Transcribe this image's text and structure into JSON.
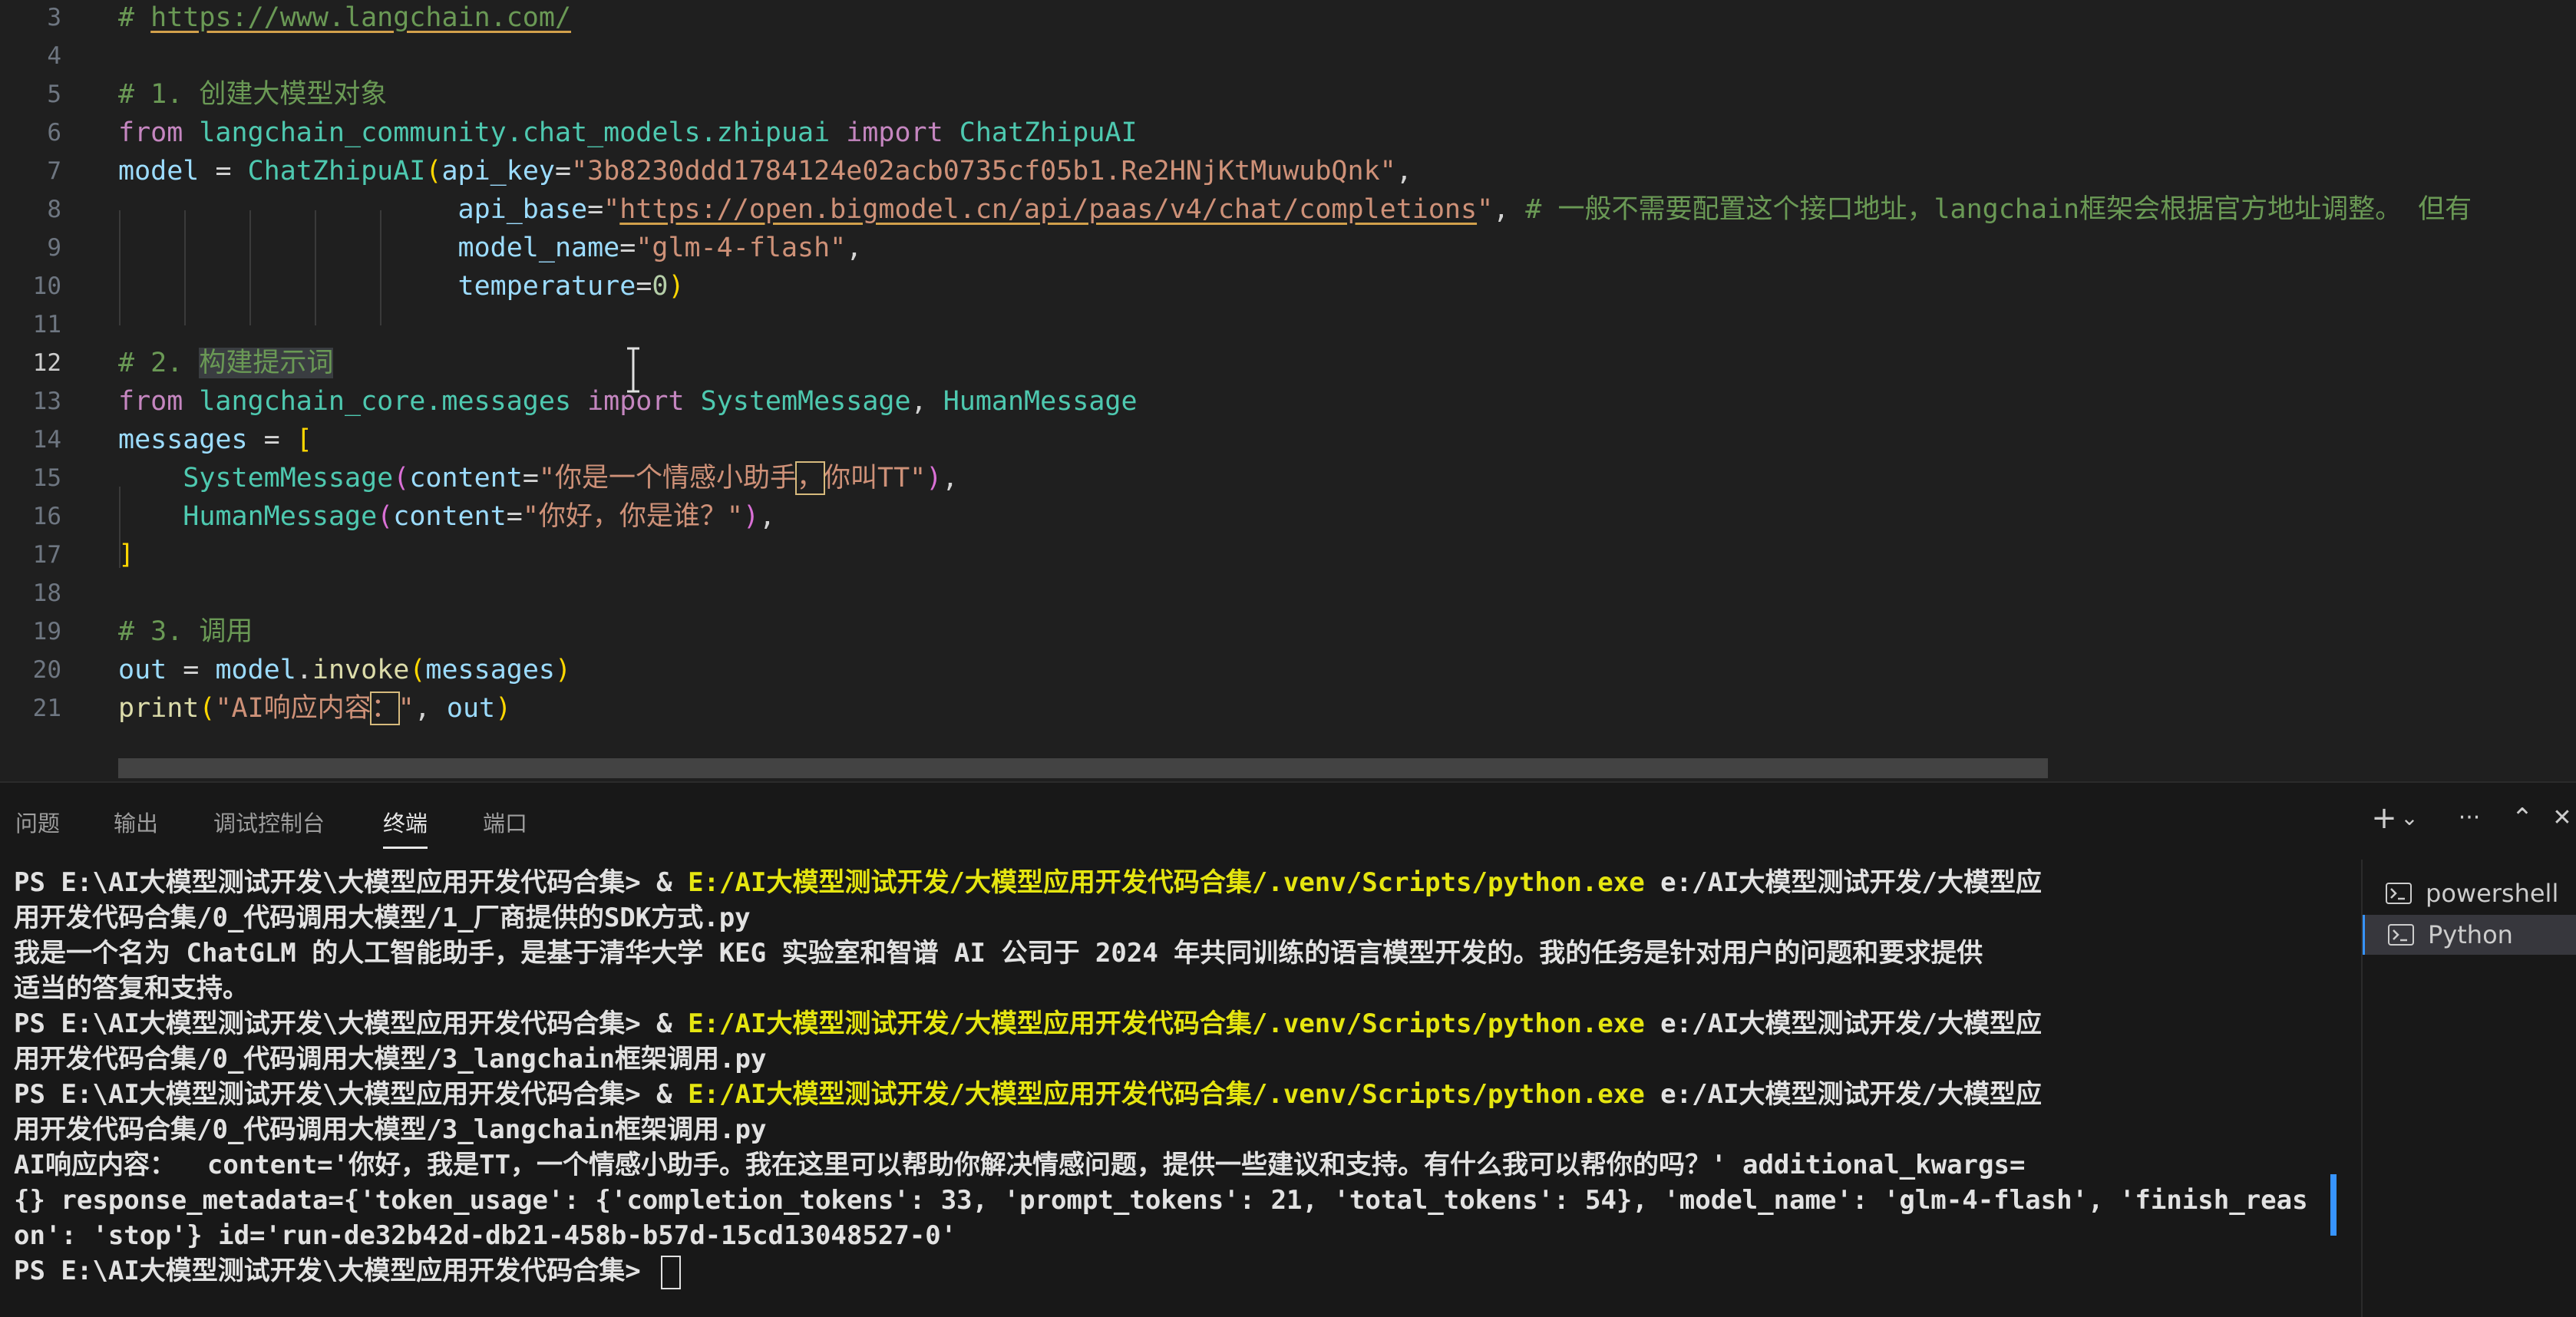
{
  "editor": {
    "lines": [
      {
        "n": "3",
        "tokens": [
          {
            "t": "# ",
            "c": "com"
          },
          {
            "t": "https://www.langchain.com/",
            "c": "com ul"
          }
        ]
      },
      {
        "n": "4",
        "tokens": []
      },
      {
        "n": "5",
        "tokens": [
          {
            "t": "# 1. 创建大模型对象",
            "c": "com"
          }
        ]
      },
      {
        "n": "6",
        "tokens": [
          {
            "t": "from ",
            "c": "kw"
          },
          {
            "t": "langchain_community.chat_models.zhipuai ",
            "c": "cls"
          },
          {
            "t": "import ",
            "c": "kw"
          },
          {
            "t": "ChatZhipuAI",
            "c": "cls"
          }
        ]
      },
      {
        "n": "7",
        "tokens": [
          {
            "t": "model ",
            "c": "var"
          },
          {
            "t": "= ",
            "c": "op"
          },
          {
            "t": "ChatZhipuAI",
            "c": "cls"
          },
          {
            "t": "(",
            "c": "br1"
          },
          {
            "t": "api_key",
            "c": "var"
          },
          {
            "t": "=",
            "c": "op"
          },
          {
            "t": "\"3b8230ddd1784124e02acb0735cf05b1.Re2HNjKtMuwubQnk\"",
            "c": "str"
          },
          {
            "t": ",",
            "c": "op"
          }
        ]
      },
      {
        "n": "8",
        "tokens": [
          {
            "t": "                     ",
            "c": "op"
          },
          {
            "t": "api_base",
            "c": "var"
          },
          {
            "t": "=",
            "c": "op"
          },
          {
            "t": "\"",
            "c": "str"
          },
          {
            "t": "https://open.bigmodel.cn/api/paas/v4/chat/completions",
            "c": "str ul"
          },
          {
            "t": "\"",
            "c": "str"
          },
          {
            "t": ", ",
            "c": "op"
          },
          {
            "t": "# 一般不需要配置这个接口地址，langchain框架会根据官方地址调整。 但有",
            "c": "com"
          }
        ]
      },
      {
        "n": "9",
        "tokens": [
          {
            "t": "                     ",
            "c": "op"
          },
          {
            "t": "model_name",
            "c": "var"
          },
          {
            "t": "=",
            "c": "op"
          },
          {
            "t": "\"glm-4-flash\"",
            "c": "str"
          },
          {
            "t": ",",
            "c": "op"
          }
        ]
      },
      {
        "n": "10",
        "tokens": [
          {
            "t": "                     ",
            "c": "op"
          },
          {
            "t": "temperature",
            "c": "var"
          },
          {
            "t": "=",
            "c": "op"
          },
          {
            "t": "0",
            "c": "num"
          },
          {
            "t": ")",
            "c": "br1"
          }
        ]
      },
      {
        "n": "11",
        "tokens": []
      },
      {
        "n": "12",
        "tokens": [
          {
            "t": "# 2. ",
            "c": "com"
          },
          {
            "t": "构建提示词",
            "c": "com sel"
          }
        ]
      },
      {
        "n": "13",
        "tokens": [
          {
            "t": "from ",
            "c": "kw"
          },
          {
            "t": "langchain_core.messages ",
            "c": "cls"
          },
          {
            "t": "import ",
            "c": "kw"
          },
          {
            "t": "SystemMessage",
            "c": "cls"
          },
          {
            "t": ", ",
            "c": "op"
          },
          {
            "t": "HumanMessage",
            "c": "cls"
          }
        ]
      },
      {
        "n": "14",
        "tokens": [
          {
            "t": "messages ",
            "c": "var"
          },
          {
            "t": "= ",
            "c": "op"
          },
          {
            "t": "[",
            "c": "br1"
          }
        ]
      },
      {
        "n": "15",
        "tokens": [
          {
            "t": "    ",
            "c": "op"
          },
          {
            "t": "SystemMessage",
            "c": "cls"
          },
          {
            "t": "(",
            "c": "br2"
          },
          {
            "t": "content",
            "c": "var"
          },
          {
            "t": "=",
            "c": "op"
          },
          {
            "t": "\"你是一个情感小助手",
            "c": "str"
          },
          {
            "t": "，",
            "c": "str warnbox"
          },
          {
            "t": "你叫TT\"",
            "c": "str"
          },
          {
            "t": ")",
            "c": "br2"
          },
          {
            "t": ",",
            "c": "op"
          }
        ]
      },
      {
        "n": "16",
        "tokens": [
          {
            "t": "    ",
            "c": "op"
          },
          {
            "t": "HumanMessage",
            "c": "cls"
          },
          {
            "t": "(",
            "c": "br2"
          },
          {
            "t": "content",
            "c": "var"
          },
          {
            "t": "=",
            "c": "op"
          },
          {
            "t": "\"你好，你是谁？\"",
            "c": "str"
          },
          {
            "t": ")",
            "c": "br2"
          },
          {
            "t": ",",
            "c": "op"
          }
        ]
      },
      {
        "n": "17",
        "tokens": [
          {
            "t": "]",
            "c": "br1"
          }
        ]
      },
      {
        "n": "18",
        "tokens": []
      },
      {
        "n": "19",
        "tokens": [
          {
            "t": "# 3. 调用",
            "c": "com"
          }
        ]
      },
      {
        "n": "20",
        "tokens": [
          {
            "t": "out ",
            "c": "var"
          },
          {
            "t": "= ",
            "c": "op"
          },
          {
            "t": "model",
            "c": "var"
          },
          {
            "t": ".",
            "c": "op"
          },
          {
            "t": "invoke",
            "c": "fn"
          },
          {
            "t": "(",
            "c": "br1"
          },
          {
            "t": "messages",
            "c": "var"
          },
          {
            "t": ")",
            "c": "br1"
          }
        ]
      },
      {
        "n": "21",
        "tokens": [
          {
            "t": "print",
            "c": "fn"
          },
          {
            "t": "(",
            "c": "br1"
          },
          {
            "t": "\"AI响应内容",
            "c": "str"
          },
          {
            "t": "：",
            "c": "str warnbox"
          },
          {
            "t": "\"",
            "c": "str"
          },
          {
            "t": ", ",
            "c": "op"
          },
          {
            "t": "out",
            "c": "var"
          },
          {
            "t": ")",
            "c": "br1"
          }
        ]
      }
    ],
    "active_line": "12"
  },
  "panel": {
    "tabs": [
      "问题",
      "输出",
      "调试控制台",
      "终端",
      "端口"
    ],
    "active_tab": "终端",
    "actions": {
      "add": "+",
      "dropdown": "⌄",
      "more": "···",
      "maximize": "⌃",
      "close": "✕"
    },
    "terminals": [
      {
        "label": "powershell",
        "icon": "terminal-icon"
      },
      {
        "label": "Python",
        "icon": "terminal-icon"
      }
    ],
    "active_terminal": "Python"
  },
  "terminal": {
    "lines": [
      [
        {
          "t": "PS E:\\AI大模型测试开发\\大模型应用开发代码合集> & "
        },
        {
          "t": "E:/AI大模型测试开发/大模型应用开发代码合集/.venv/Scripts/python.exe",
          "c": "path-y"
        },
        {
          "t": " e:/AI大模型测试开发/大模型应"
        }
      ],
      [
        {
          "t": "用开发代码合集/0_代码调用大模型/1_厂商提供的SDK方式.py"
        }
      ],
      [
        {
          "t": "我是一个名为 ChatGLM 的人工智能助手，是基于清华大学 KEG 实验室和智谱 AI 公司于 2024 年共同训练的语言模型开发的。我的任务是针对用户的问题和要求提供"
        }
      ],
      [
        {
          "t": "适当的答复和支持。"
        }
      ],
      [
        {
          "t": "PS E:\\AI大模型测试开发\\大模型应用开发代码合集> & "
        },
        {
          "t": "E:/AI大模型测试开发/大模型应用开发代码合集/.venv/Scripts/python.exe",
          "c": "path-y"
        },
        {
          "t": " e:/AI大模型测试开发/大模型应"
        }
      ],
      [
        {
          "t": "用开发代码合集/0_代码调用大模型/3_langchain框架调用.py"
        }
      ],
      [
        {
          "t": "PS E:\\AI大模型测试开发\\大模型应用开发代码合集> & "
        },
        {
          "t": "E:/AI大模型测试开发/大模型应用开发代码合集/.venv/Scripts/python.exe",
          "c": "path-y"
        },
        {
          "t": " e:/AI大模型测试开发/大模型应"
        }
      ],
      [
        {
          "t": "用开发代码合集/0_代码调用大模型/3_langchain框架调用.py"
        }
      ],
      [
        {
          "t": "AI响应内容：  content='你好，我是TT，一个情感小助手。我在这里可以帮助你解决情感问题，提供一些建议和支持。有什么我可以帮你的吗？' additional_kwargs="
        }
      ],
      [
        {
          "t": "{} response_metadata={'token_usage': {'completion_tokens': 33, 'prompt_tokens': 21, 'total_tokens': 54}, 'model_name': 'glm-4-flash', 'finish_reas"
        }
      ],
      [
        {
          "t": "on': 'stop'} id='run-de32b42d-db21-458b-b57d-15cd13048527-0'"
        }
      ],
      [
        {
          "t": "PS E:\\AI大模型测试开发\\大模型应用开发代码合集> "
        }
      ]
    ]
  }
}
